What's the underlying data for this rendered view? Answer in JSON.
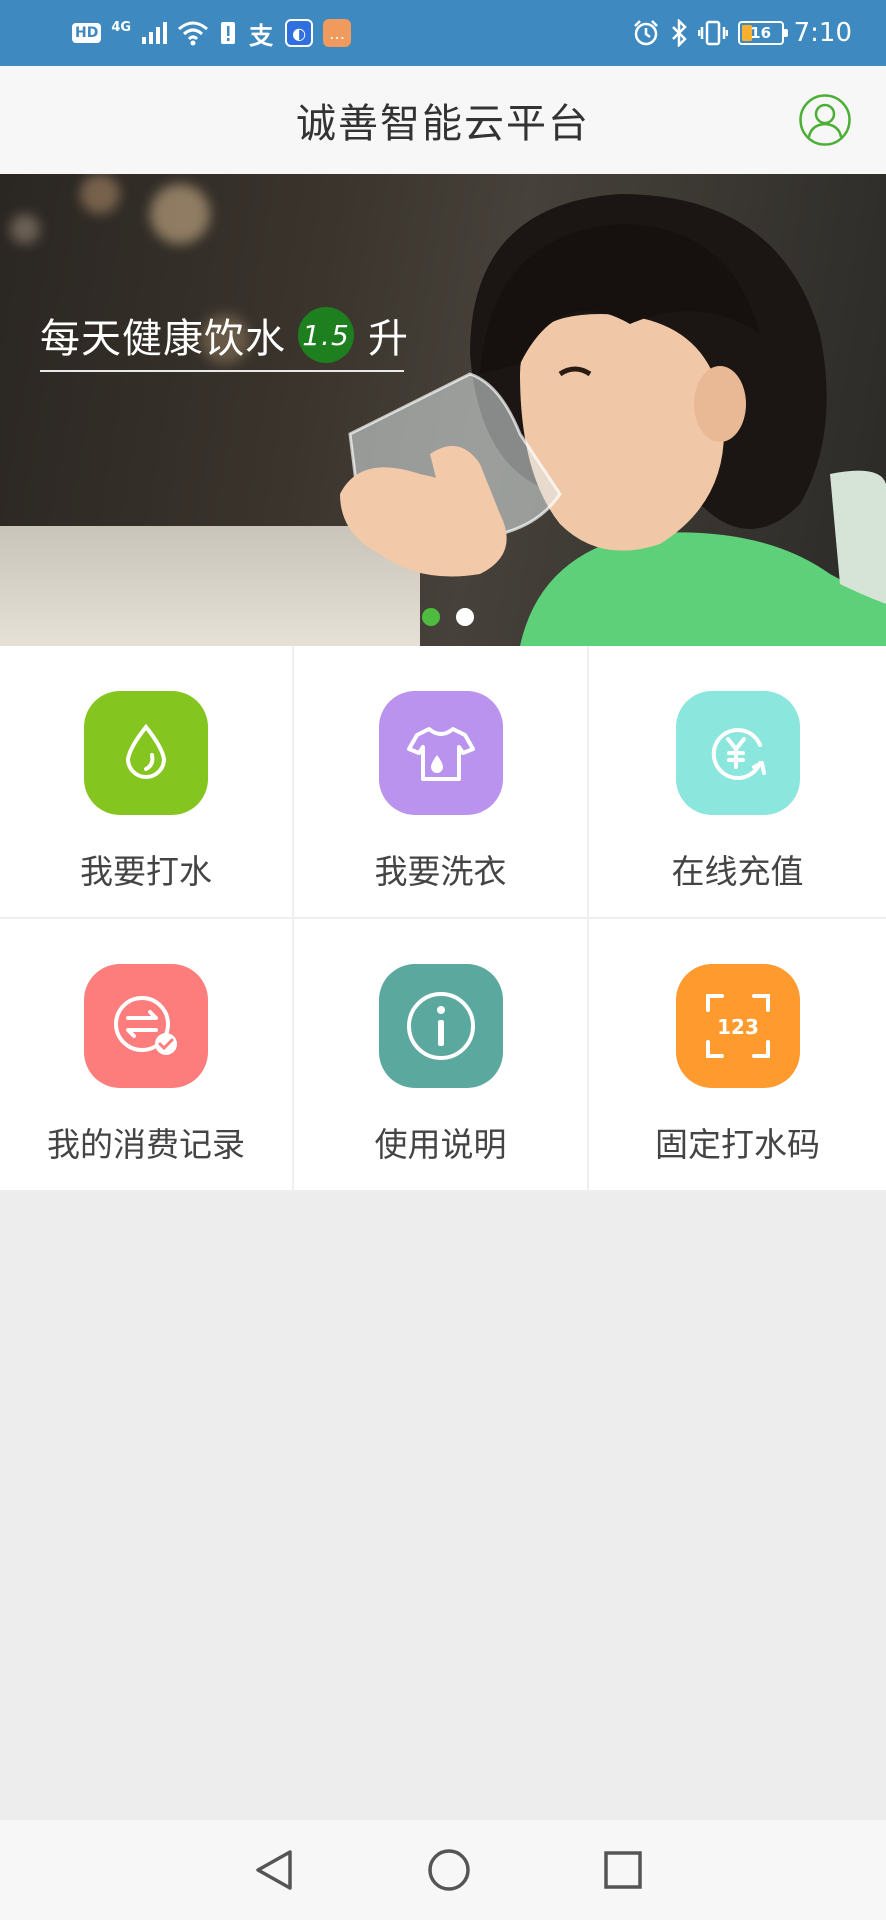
{
  "status_bar": {
    "left_indicators": [
      "HD",
      "4G"
    ],
    "battery_level": "16",
    "time": "7:10",
    "icons": [
      "hd-icon",
      "signal-icon",
      "wifi-icon",
      "sim-alert-icon",
      "alipay-icon",
      "browser-icon",
      "message-icon",
      "alarm-icon",
      "bluetooth-icon",
      "vibrate-icon",
      "battery-icon"
    ]
  },
  "header": {
    "title": "诚善智能云平台",
    "profile_icon": "user-outline-icon",
    "accent_color": "#4caf35"
  },
  "banner": {
    "text_prefix": "每天健康饮水",
    "badge": "1.5",
    "text_suffix": "升",
    "slides_total": 2,
    "active_slide": 1
  },
  "menu": {
    "items": [
      {
        "label": "我要打水",
        "icon": "water-drop-icon",
        "color": "#85c51f"
      },
      {
        "label": "我要洗衣",
        "icon": "laundry-shirt-icon",
        "color": "#b993ee"
      },
      {
        "label": "在线充值",
        "icon": "yuan-recharge-icon",
        "color": "#8be6dd"
      },
      {
        "label": "我的消费记录",
        "icon": "transaction-record-icon",
        "color": "#fd7c7c"
      },
      {
        "label": "使用说明",
        "icon": "info-icon",
        "color": "#5aa89e"
      },
      {
        "label": "固定打水码",
        "icon": "code-scan-icon",
        "color": "#ff9a2e"
      }
    ]
  },
  "nav": {
    "back": "back-triangle-icon",
    "home": "home-circle-icon",
    "recents": "recents-square-icon"
  }
}
